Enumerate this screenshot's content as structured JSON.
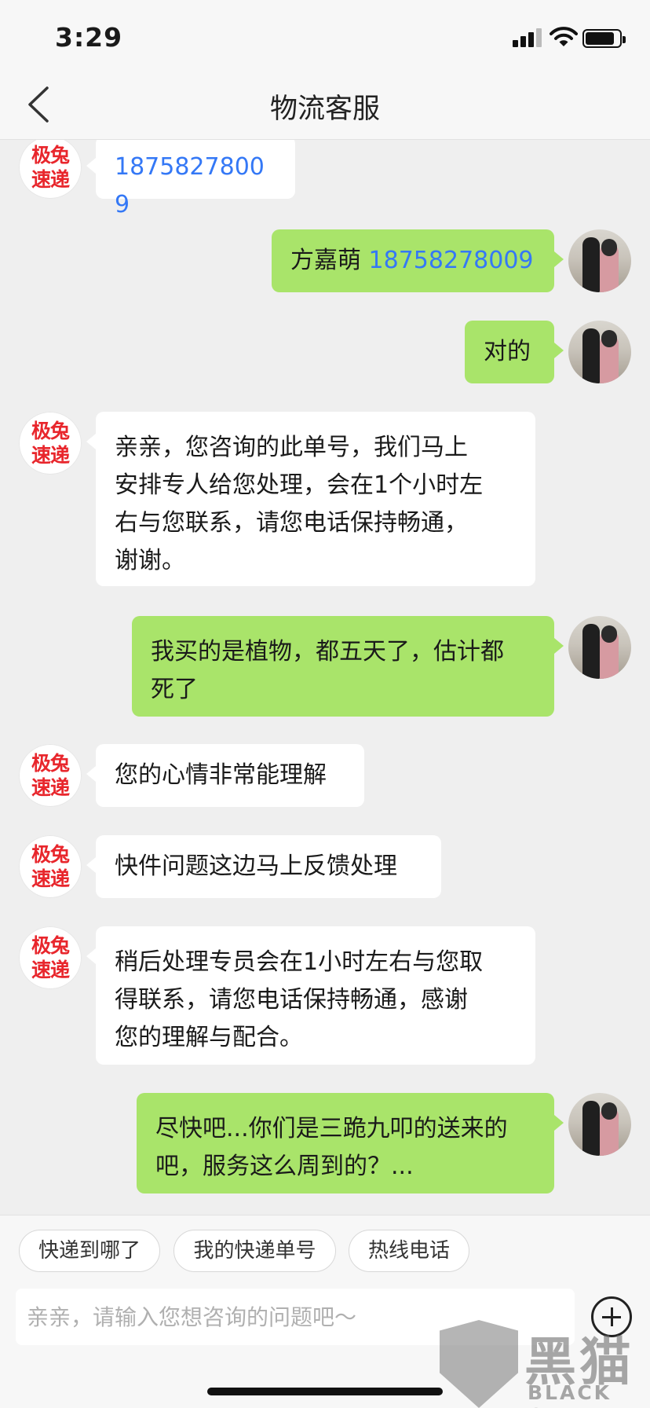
{
  "status_bar": {
    "time": "3:29"
  },
  "nav": {
    "back_icon": "chevron-left-icon",
    "title": "物流客服"
  },
  "brand_avatar": {
    "line1": "极兔",
    "line2": "速递",
    "color": "#e8262c"
  },
  "messages": [
    {
      "side": "left",
      "phone": "18758278009"
    },
    {
      "side": "right",
      "name": "方嘉萌",
      "phone": "18758278009"
    },
    {
      "side": "right",
      "text": "对的"
    },
    {
      "side": "left",
      "lines": [
        "亲亲，您咨询的此单号，我们马上",
        "安排专人给您处理，会在1个小时左",
        "右与您联系，请您电话保持畅通，",
        "谢谢。"
      ]
    },
    {
      "side": "right",
      "lines": [
        "我买的是植物，都五天了，估计都",
        "死了"
      ]
    },
    {
      "side": "left",
      "text": "您的心情非常能理解"
    },
    {
      "side": "left",
      "text": "快件问题这边马上反馈处理"
    },
    {
      "side": "left",
      "lines": [
        "稍后处理专员会在1小时左右与您取",
        "得联系，请您电话保持畅通，感谢",
        "您的理解与配合。"
      ]
    },
    {
      "side": "right",
      "lines": [
        "尽快吧...你们是三跪九叩的送来的",
        "吧，服务这么周到的？..."
      ]
    }
  ],
  "quick_replies": [
    "快递到哪了",
    "我的快递单号",
    "热线电话"
  ],
  "input": {
    "placeholder": "亲亲，请输入您想咨询的问题吧～",
    "value": "",
    "plus_icon": "plus-circle-icon"
  },
  "watermark": {
    "cn": "黑猫",
    "en": "BLACK CAT"
  },
  "colors": {
    "user_bubble": "#a9e46a",
    "agent_bubble": "#ffffff",
    "link": "#3478f6",
    "background": "#efefef"
  }
}
